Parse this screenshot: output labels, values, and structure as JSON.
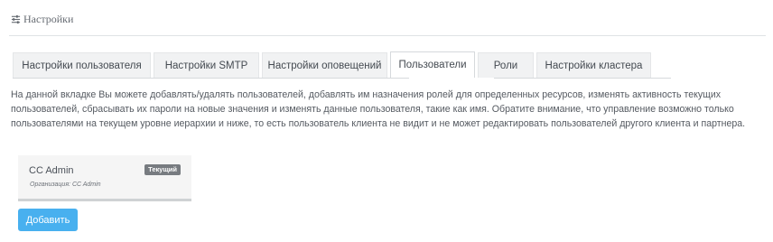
{
  "header": {
    "icon": "sliders-icon",
    "title": "Настройки"
  },
  "tabs": [
    {
      "label": "Настройки пользователя",
      "active": false
    },
    {
      "label": "Настройки SMTP",
      "active": false
    },
    {
      "label": "Настройки оповещений",
      "active": false
    },
    {
      "label": "Пользователи",
      "active": true
    },
    {
      "label": "Роли",
      "active": false
    },
    {
      "label": "Настройки кластера",
      "active": false
    }
  ],
  "description": "На данной вкладке Вы можете добавлять/удалять пользователей, добавлять им назначения ролей для определенных ресурсов, изменять активность текущих пользователей, сбрасывать их пароли на новые значения и изменять данные пользователя, такие как имя. Обратите внимание, что управление возможно только пользователями на текущем уровне иерархии и ниже, то есть пользователь клиента не видит и не может редактировать пользователей другого клиента и партнера.",
  "user_card": {
    "name": "CC Admin",
    "badge": "Текущий",
    "organization": "Организация: CC Admin"
  },
  "add_button": {
    "label": "Добавить"
  },
  "colors": {
    "accent": "#48b0ef",
    "badge": "#777b80",
    "tab_bg": "#f1f2f3"
  }
}
